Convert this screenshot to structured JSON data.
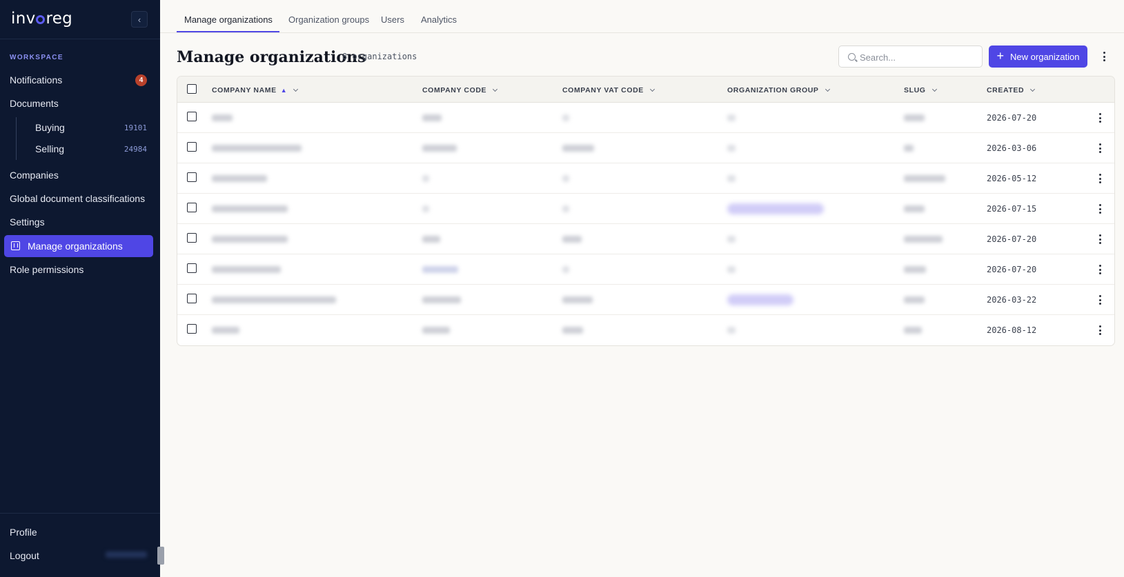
{
  "sidebar": {
    "brand": "invoreg",
    "section_label": "WORKSPACE",
    "items": [
      {
        "label": "Notifications",
        "badge": "4"
      },
      {
        "label": "Documents"
      },
      {
        "label": "Buying",
        "count": "19101"
      },
      {
        "label": "Selling",
        "count": "24984"
      },
      {
        "label": "Companies"
      },
      {
        "label": "Global document classifications"
      },
      {
        "label": "Settings"
      },
      {
        "label": "Manage organizations",
        "active": true
      },
      {
        "label": "Role permissions"
      }
    ],
    "footer": [
      {
        "label": "Profile"
      },
      {
        "label": "Logout"
      }
    ]
  },
  "tabs": [
    {
      "label": "Manage organizations",
      "active": true
    },
    {
      "label": "Organization groups"
    },
    {
      "label": "Users"
    },
    {
      "label": "Analytics"
    }
  ],
  "header": {
    "title": "Manage organizations",
    "count": "8 organizations",
    "search_placeholder": "Search...",
    "new_button": "New organization"
  },
  "table": {
    "columns": [
      "COMPANY NAME",
      "COMPANY CODE",
      "COMPANY VAT CODE",
      "ORGANIZATION GROUP",
      "SLUG",
      "CREATED"
    ],
    "sort_column": "COMPANY NAME",
    "sort_direction": "ascending",
    "rows": [
      {
        "created": "2026-07-20"
      },
      {
        "created": "2026-03-06"
      },
      {
        "created": "2026-05-12"
      },
      {
        "created": "2026-07-15"
      },
      {
        "created": "2026-07-20"
      },
      {
        "created": "2026-07-20"
      },
      {
        "created": "2026-03-22"
      },
      {
        "created": "2026-08-12"
      }
    ]
  },
  "colors": {
    "accent": "#4f46e5",
    "sidebar_bg": "#0d1830",
    "badge": "#b8412b",
    "page_bg": "#faf9f6"
  }
}
